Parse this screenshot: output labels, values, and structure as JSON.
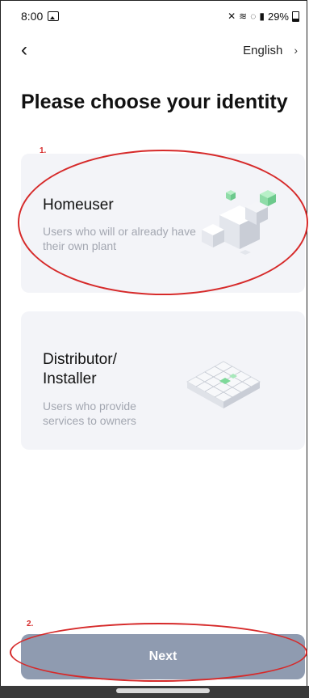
{
  "status": {
    "time": "8:00",
    "battery": "29%",
    "icons": [
      "gallery-icon",
      "mute-icon",
      "wifi-icon",
      "hotspot-icon",
      "signal-icon",
      "battery-icon"
    ]
  },
  "nav": {
    "back_icon": "back-chevron-icon",
    "language": "English",
    "language_icon": "chevron-right-icon"
  },
  "page": {
    "title": "Please choose your identity"
  },
  "options": [
    {
      "title": "Homeuser",
      "description": "Users who will or already have their own plant",
      "illustration": "cubes-illustration"
    },
    {
      "title": "Distributor/ Installer",
      "description": "Users who provide services to owners",
      "illustration": "grid-illustration"
    }
  ],
  "annotations": [
    "1.",
    "2."
  ],
  "footer": {
    "next_label": "Next"
  },
  "colors": {
    "card_bg": "#f3f4f8",
    "button_bg": "#8f9bb0",
    "annotation": "#d62a2a",
    "accent_green": "#7fd99a"
  }
}
